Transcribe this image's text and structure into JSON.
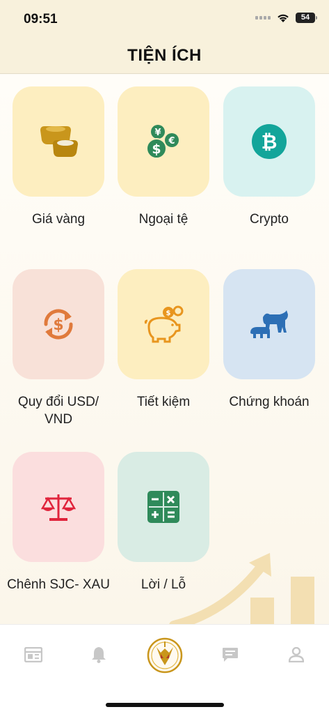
{
  "status_bar": {
    "time": "09:51",
    "battery": "54"
  },
  "header": {
    "title": "TIỆN ÍCH"
  },
  "tiles": [
    {
      "label": "Giá vàng",
      "bg": "#fdeec0",
      "icon": "gold-bars-icon"
    },
    {
      "label": "Ngoại tệ",
      "bg": "#fdeec0",
      "icon": "currency-coins-icon"
    },
    {
      "label": "Crypto",
      "bg": "#d8f2f0",
      "icon": "bitcoin-icon"
    },
    {
      "label": "Quy đổi USD/ VND",
      "bg": "#f8e1d8",
      "icon": "currency-exchange-icon"
    },
    {
      "label": "Tiết kiệm",
      "bg": "#fdeec0",
      "icon": "piggy-bank-icon"
    },
    {
      "label": "Chứng khoán",
      "bg": "#d6e4f2",
      "icon": "bull-bear-icon"
    },
    {
      "label": "Chênh SJC- XAU",
      "bg": "#fbdede",
      "icon": "balance-scale-icon"
    },
    {
      "label": "Lời / Lỗ",
      "bg": "#d9ece4",
      "icon": "calculator-icon"
    }
  ],
  "tab_bar": {
    "items": [
      {
        "name": "news",
        "icon": "newspaper-icon"
      },
      {
        "name": "notifications",
        "icon": "bell-icon"
      },
      {
        "name": "home",
        "icon": "app-logo-icon"
      },
      {
        "name": "messages",
        "icon": "chat-icon"
      },
      {
        "name": "profile",
        "icon": "user-icon"
      }
    ]
  },
  "colors": {
    "header_bg": "#f8f1dc",
    "gold": "#c9961c",
    "tab_icon": "#c7c7c7"
  }
}
